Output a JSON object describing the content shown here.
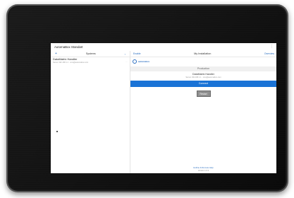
{
  "app": {
    "title": "AutomaBox Standart",
    "menu_icon": "kebab-icon"
  },
  "sidebar": {
    "add_icon": "plus-icon",
    "heading": "Systems",
    "back_icon": "chevron-left-icon",
    "items": [
      {
        "name": "DataMatrix Handler",
        "desc": "Server 192.168.1.1 · sms@automabox.com",
        "more": "···"
      }
    ]
  },
  "detail": {
    "edit_label": "Enable",
    "title": "My Installation",
    "done_label": "Overview",
    "logo_text": "automabox",
    "section_label": "Production",
    "info_name": "DataMatrix Handler",
    "info_desc": "Server 192.168.1.1 · sms@automabox.com",
    "primary_label": "Connect",
    "secondary_label": "Restart",
    "footer_line1": "Hotline & Remote Help",
    "footer_line2": "Version 1.0.3"
  },
  "colors": {
    "accent": "#1a73d6",
    "link": "#2b6fc1",
    "bezel": "#2e2e2e"
  }
}
